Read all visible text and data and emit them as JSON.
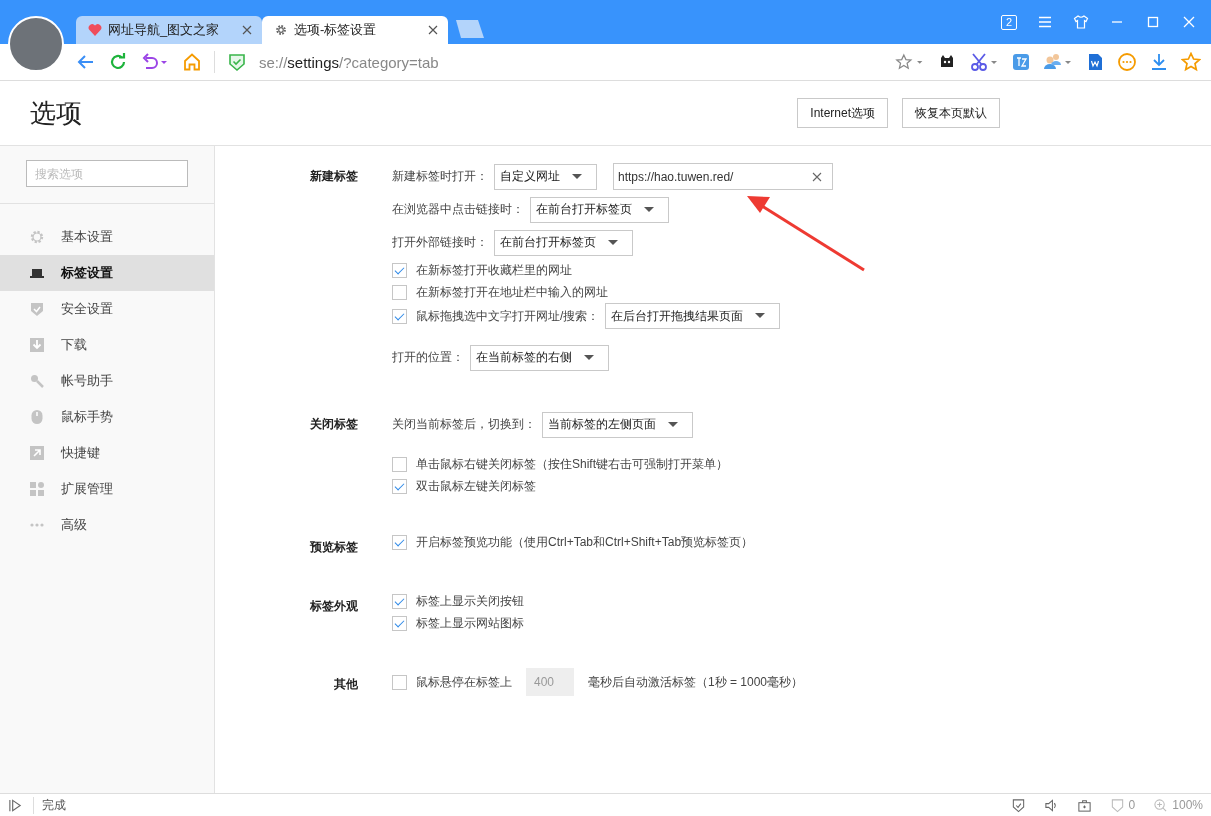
{
  "browser": {
    "tabs": [
      {
        "kind": "site",
        "title": "网址导航_图文之家",
        "selected": false
      },
      {
        "kind": "settings",
        "title": "选项-标签设置",
        "selected": true
      }
    ],
    "tab_count": "2",
    "address": {
      "scheme": "se://",
      "host": "settings",
      "path": "/?category=tab"
    }
  },
  "header": {
    "title": "选项",
    "buttons": [
      "Internet选项",
      "恢复本页默认"
    ]
  },
  "sidebar": {
    "search": {
      "placeholder": "搜索选项"
    },
    "items": [
      {
        "label": "基本设置",
        "selected": false
      },
      {
        "label": "标签设置",
        "selected": true
      },
      {
        "label": "安全设置",
        "selected": false
      },
      {
        "label": "下载",
        "selected": false
      },
      {
        "label": "帐号助手",
        "selected": false
      },
      {
        "label": "鼠标手势",
        "selected": false
      },
      {
        "label": "快捷键",
        "selected": false
      },
      {
        "label": "扩展管理",
        "selected": false
      },
      {
        "label": "高级",
        "selected": false
      }
    ]
  },
  "sections": [
    {
      "label": "新建标签",
      "groups": [
        [
          {
            "kind": "select",
            "label": "新建标签时打开：",
            "value": "自定义网址",
            "url": "https://hao.tuwen.red/"
          },
          {
            "kind": "select",
            "label": "在浏览器中点击链接时：",
            "value": "在前台打开标签页"
          },
          {
            "kind": "select",
            "label": "打开外部链接时：",
            "value": "在前台打开标签页"
          },
          {
            "kind": "checkbox",
            "label": "在新标签打开收藏栏里的网址",
            "checked": true
          },
          {
            "kind": "checkbox",
            "label": "在新标签打开在地址栏中输入的网址",
            "checked": false
          },
          {
            "kind": "checkbox",
            "label": "鼠标拖拽选中文字打开网址/搜索：",
            "checked": true,
            "value": "在后台打开拖拽结果页面"
          }
        ],
        [
          {
            "kind": "select",
            "label": "打开的位置：",
            "value": "在当前标签的右侧"
          }
        ]
      ]
    },
    {
      "label": "关闭标签",
      "groups": [
        [
          {
            "kind": "select",
            "label": "关闭当前标签后，切换到：",
            "value": "当前标签的左侧页面"
          }
        ],
        [
          {
            "kind": "checkbox",
            "label": "单击鼠标右键关闭标签（按住Shift键右击可强制打开菜单）",
            "checked": false
          },
          {
            "kind": "checkbox",
            "label": "双击鼠标左键关闭标签",
            "checked": true
          }
        ]
      ]
    },
    {
      "label": "预览标签",
      "groups": [
        [
          {
            "kind": "checkbox",
            "label": "开启标签预览功能（使用Ctrl+Tab和Ctrl+Shift+Tab预览标签页）",
            "checked": true
          }
        ]
      ]
    },
    {
      "label": "标签外观",
      "groups": [
        [
          {
            "kind": "checkbox",
            "label": "标签上显示关闭按钮",
            "checked": true
          },
          {
            "kind": "checkbox",
            "label": "标签上显示网站图标",
            "checked": true
          }
        ]
      ]
    },
    {
      "label": "其他",
      "groups": [
        [
          {
            "kind": "delay",
            "label": "鼠标悬停在标签上",
            "checked": false,
            "value": "400",
            "suffix": "毫秒后自动激活标签（1秒 = 1000毫秒）"
          }
        ]
      ]
    }
  ],
  "status_bar": {
    "text": "完成",
    "ad_count": "0",
    "zoom": "100%"
  }
}
